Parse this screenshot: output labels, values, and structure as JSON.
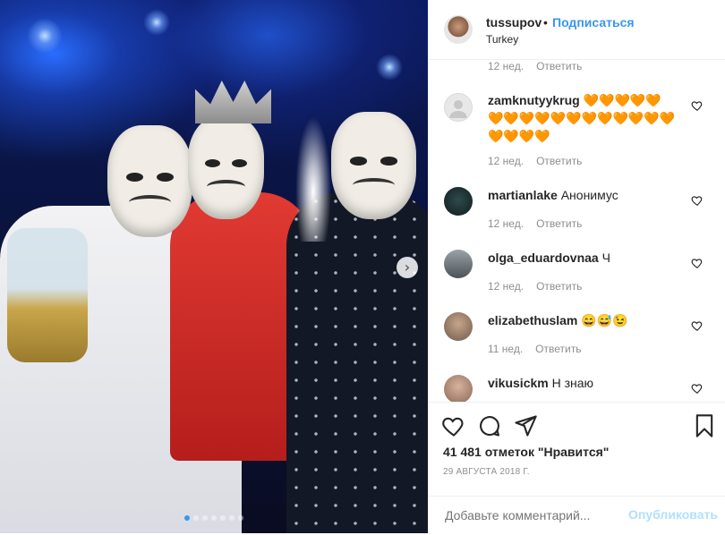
{
  "post": {
    "username": "tussupov",
    "separator": "•",
    "follow_label": "Подписаться",
    "location": "Turkey",
    "media": {
      "slide_count": 7,
      "active_slide": 1,
      "next_icon": "chevron-right-icon"
    }
  },
  "comments": [
    {
      "time": "12 нед.",
      "reply": "Ответить"
    },
    {
      "user": "zamknutyykrug",
      "text": "🧡🧡🧡🧡🧡🧡🧡🧡🧡🧡🧡🧡🧡🧡🧡🧡🧡🧡🧡🧡🧡",
      "time": "12 нед.",
      "reply": "Ответить"
    },
    {
      "user": "martianlake",
      "text": "Анонимус",
      "time": "12 нед.",
      "reply": "Ответить"
    },
    {
      "user": "olga_eduardovnaa",
      "text": "Ч",
      "time": "12 нед.",
      "reply": "Ответить"
    },
    {
      "user": "elizabethuslam",
      "text": "😄😅😉",
      "time": "11 нед.",
      "reply": "Ответить"
    },
    {
      "user": "vikusickm",
      "text": "Н знаю"
    }
  ],
  "actions": {
    "like_icon": "heart-icon",
    "comment_icon": "comment-icon",
    "share_icon": "share-icon",
    "save_icon": "bookmark-icon",
    "likes_text": "41 481 отметок \"Нравится\"",
    "date_text": "29 АВГУСТА 2018 Г."
  },
  "comment_form": {
    "placeholder": "Добавьте комментарий...",
    "publish_label": "Опубликовать"
  },
  "colors": {
    "link": "#3897f0",
    "muted": "#8e8e8e",
    "publish_disabled": "#b2dffc"
  }
}
